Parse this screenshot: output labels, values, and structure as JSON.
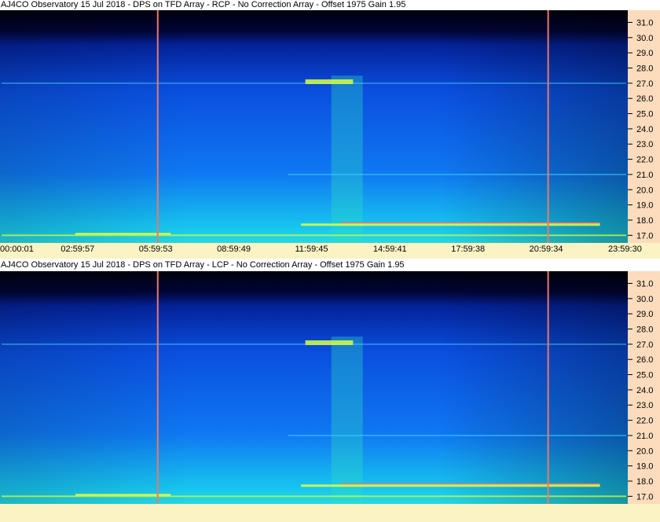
{
  "panels": [
    {
      "title": "AJ4CO Observatory 15 Jul 2018 - DPS on TFD Array  - RCP  -  No Correction Array  -  Offset 1975  Gain 1.95",
      "polarization": "RCP",
      "show_time_axis": true
    },
    {
      "title": "AJ4CO Observatory 15 Jul 2018 - DPS on TFD Array  - LCP  -  No Correction Array  -  Offset 1975  Gain 1.95",
      "polarization": "LCP",
      "show_time_axis": false
    }
  ],
  "chart_data": {
    "type": "heatmap",
    "title": "AJ4CO Observatory 15 Jul 2018 - DPS on TFD Array",
    "xlabel": "",
    "ylabel": "",
    "x_ticks": [
      "00:00:01",
      "02:59:57",
      "05:59:53",
      "08:59:49",
      "11:59:45",
      "14:59:41",
      "17:59:38",
      "20:59:34",
      "23:59:30"
    ],
    "y_ticks": [
      17.0,
      18.0,
      19.0,
      20.0,
      21.0,
      22.0,
      23.0,
      24.0,
      25.0,
      26.0,
      27.0,
      28.0,
      29.0,
      30.0,
      31.0
    ],
    "y_range": [
      16.5,
      31.8
    ],
    "grid": false,
    "colormap": "jet",
    "colors": {
      "low": "#000010",
      "mid": "#1060ff",
      "high": "#ffff30",
      "markers": "#e87a6a",
      "freq_axis_bg": "#fcdcbc",
      "time_axis_bg": "#fbf3c4"
    },
    "vertical_markers": [
      "05:59:53",
      "20:59:34"
    ]
  }
}
